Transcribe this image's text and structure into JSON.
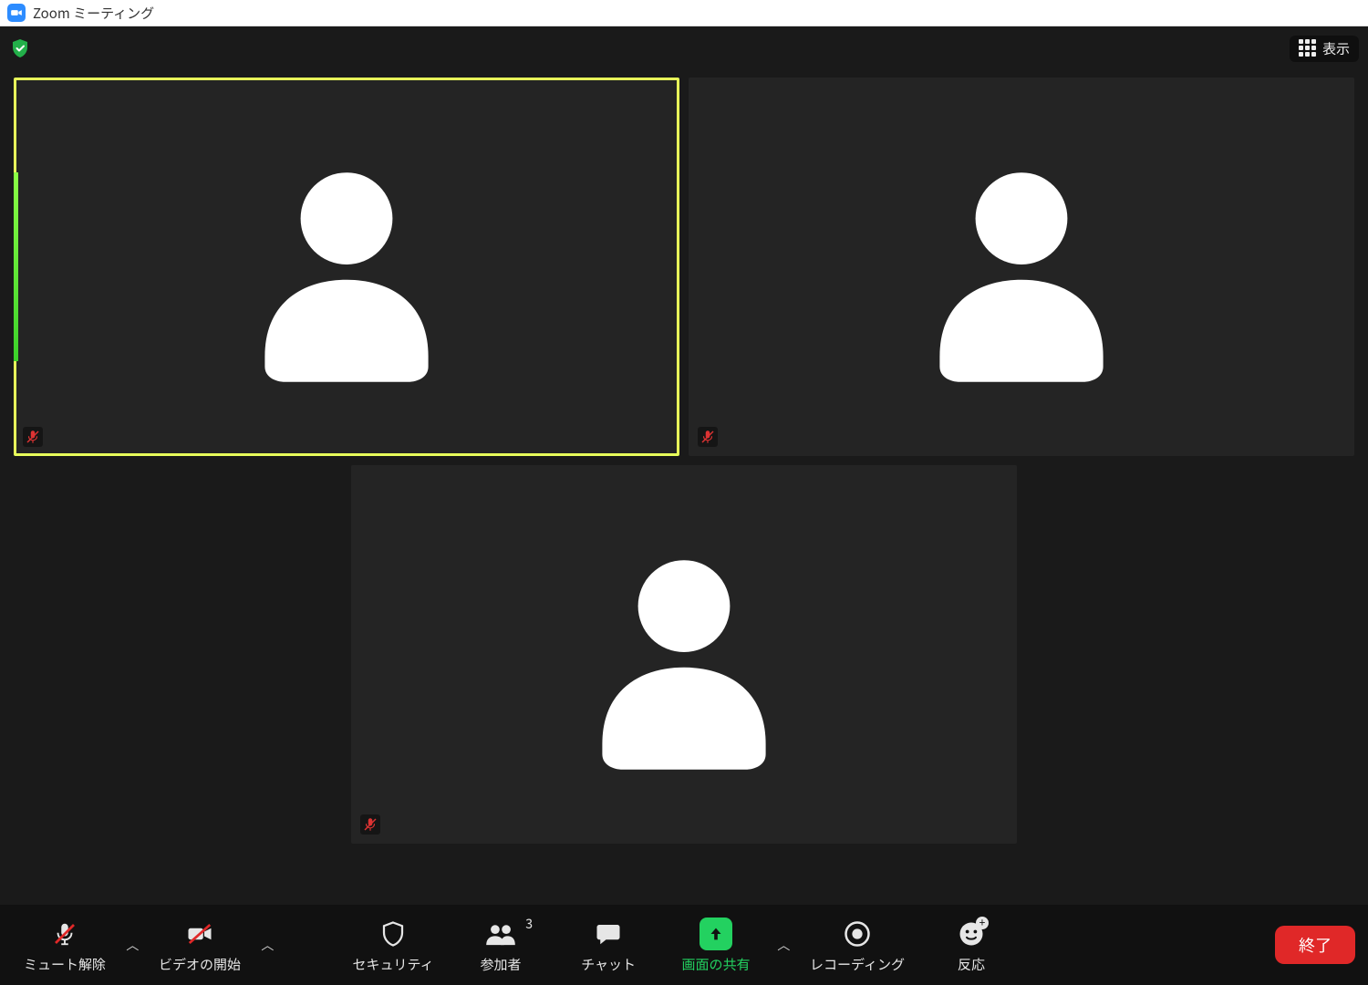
{
  "window": {
    "title": "Zoom ミーティング"
  },
  "header": {
    "view_label": "表示"
  },
  "participants": [
    {
      "muted": true,
      "active": true
    },
    {
      "muted": true,
      "active": false
    },
    {
      "muted": true,
      "active": false
    }
  ],
  "toolbar": {
    "unmute": "ミュート解除",
    "video": "ビデオの開始",
    "security": "セキュリティ",
    "participants": "参加者",
    "participant_count": "3",
    "chat": "チャット",
    "share": "画面の共有",
    "record": "レコーディング",
    "reactions": "反応",
    "end": "終了"
  }
}
